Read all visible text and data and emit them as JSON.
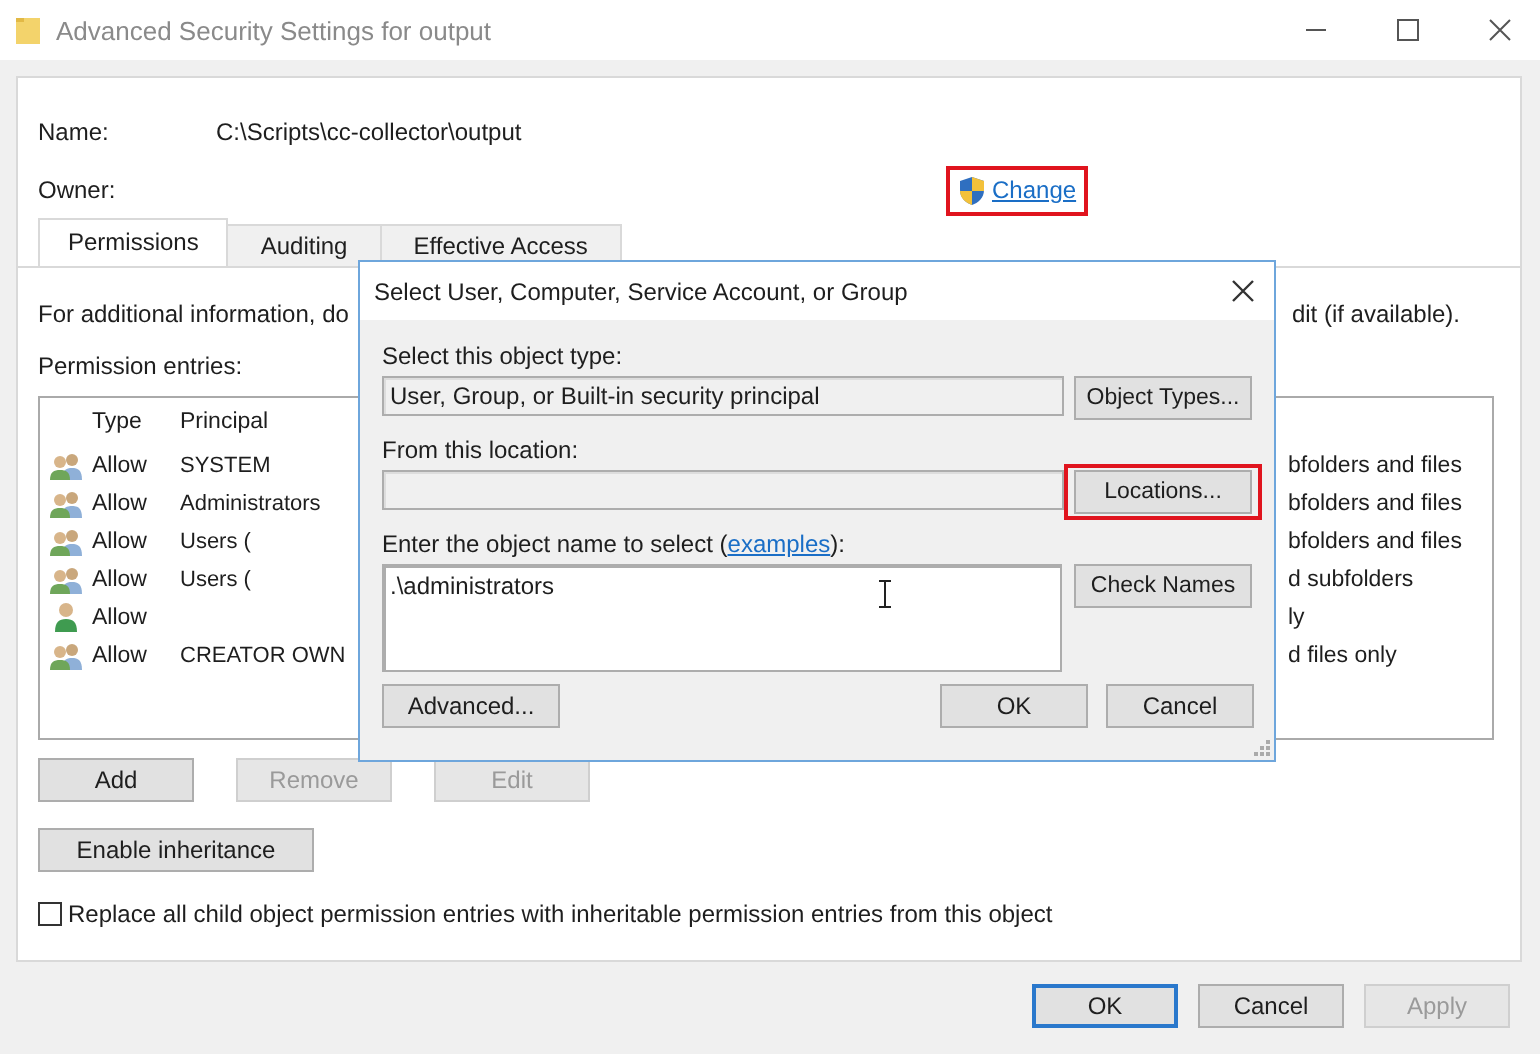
{
  "window": {
    "title": "Advanced Security Settings for output"
  },
  "name_label": "Name:",
  "name_value": "C:\\Scripts\\cc-collector\\output",
  "owner_label": "Owner:",
  "change_link": {
    "label": "Change",
    "highlighted": true
  },
  "tabs": [
    {
      "label": "Permissions",
      "selected": true
    },
    {
      "label": "Auditing",
      "selected": false
    },
    {
      "label": "Effective Access",
      "selected": false
    }
  ],
  "info_text_start": "For additional information, do",
  "info_text_end": "dit (if available).",
  "entries_label": "Permission entries:",
  "columns": [
    "Type",
    "Principal"
  ],
  "rows": [
    {
      "kind": "group",
      "type": "Allow",
      "principal": "SYSTEM",
      "applies_to": "bfolders and files"
    },
    {
      "kind": "group",
      "type": "Allow",
      "principal": "Administrators",
      "applies_to": "bfolders and files"
    },
    {
      "kind": "group",
      "type": "Allow",
      "principal": "Users (",
      "applies_to": "bfolders and files"
    },
    {
      "kind": "group",
      "type": "Allow",
      "principal": "Users (",
      "applies_to": "d subfolders"
    },
    {
      "kind": "user",
      "type": "Allow",
      "applies_to": "ly"
    },
    {
      "kind": "group",
      "type": "Allow",
      "principal": "CREATOR OWN",
      "applies_to": "d files only"
    }
  ],
  "table_buttons": [
    {
      "label": "Add",
      "disabled": false
    },
    {
      "label": "Remove",
      "disabled": true
    },
    {
      "label": "Edit",
      "disabled": true
    }
  ],
  "inheritance_button": "Enable inheritance",
  "replace_checkbox": {
    "label": "Replace all child object permission entries with inheritable permission entries from this object",
    "checked": false
  },
  "footer_buttons": [
    {
      "label": "OK",
      "default": true,
      "disabled": false
    },
    {
      "label": "Cancel",
      "default": false,
      "disabled": false
    },
    {
      "label": "Apply",
      "default": false,
      "disabled": true
    }
  ],
  "dialog": {
    "title": "Select User, Computer, Service Account, or Group",
    "object_type_label": "Select this object type:",
    "object_type_value": "User, Group, or Built-in security principal",
    "object_types_button": {
      "label": "Object Types...",
      "highlighted": false
    },
    "location_label": "From this location:",
    "locations_button": {
      "label": "Locations...",
      "highlighted": true
    },
    "name_label_start": "Enter the object name to select (",
    "examples_link": "examples",
    "name_label_end": "):",
    "name_value": ".\\administrators",
    "check_names_button": "Check Names",
    "advanced_button": "Advanced...",
    "ok_button": "OK",
    "cancel_button": "Cancel"
  }
}
